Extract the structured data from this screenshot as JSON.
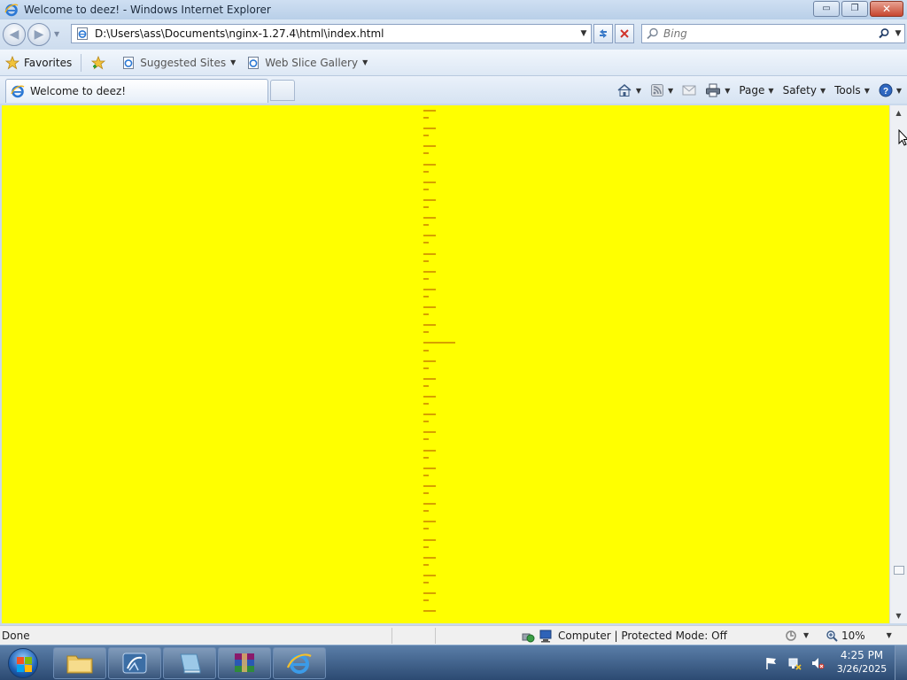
{
  "window": {
    "title": "Welcome to deez! - Windows Internet Explorer",
    "minimize_label": "▭",
    "restore_label": "❐",
    "close_label": "✕"
  },
  "nav": {
    "address": "D:\\Users\\ass\\Documents\\nginx-1.27.4\\html\\index.html",
    "search_placeholder": "Bing",
    "back_label": "◀",
    "forward_label": "▶"
  },
  "favorites_bar": {
    "favorites_label": "Favorites",
    "suggested_sites_label": "Suggested Sites",
    "web_slice_gallery_label": "Web Slice Gallery"
  },
  "tabs": [
    {
      "label": "Welcome to deez!"
    }
  ],
  "command_bar": {
    "page_label": "Page",
    "safety_label": "Safety",
    "tools_label": "Tools"
  },
  "content": {
    "background_color": "#ffff00",
    "text_color": "#d7a000"
  },
  "status_bar": {
    "status_text": "Done",
    "zone_text": "Computer | Protected Mode: Off",
    "zoom_text": "10%"
  },
  "taskbar": {
    "time": "4:25 PM",
    "date": "3/26/2025",
    "pinned": [
      "folder-icon",
      "network-icon",
      "notebook-icon",
      "winrar-icon",
      "internet-explorer-icon"
    ]
  }
}
